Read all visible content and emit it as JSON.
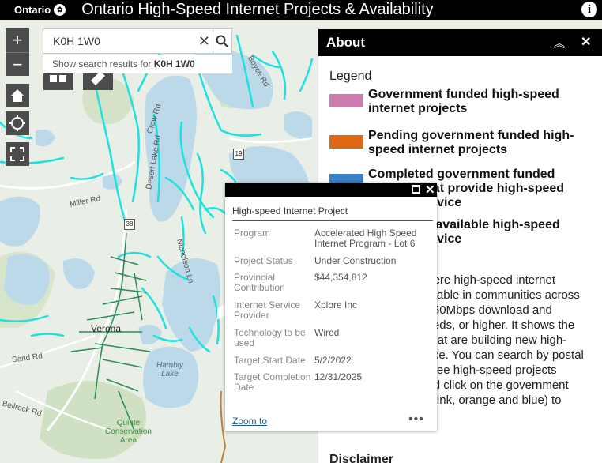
{
  "header": {
    "brand": "Ontario",
    "title": "Ontario High-Speed Internet Projects & Availability",
    "info_icon": "info-icon"
  },
  "map": {
    "labels": {
      "road1": "Miller Rd",
      "road2": "Sand Rd",
      "road3": "Bellrock Rd",
      "road4": "Crow Rd",
      "road5": "Desert Lake Rd",
      "road6": "Nicholson Ln",
      "road7": "Boyce Rd",
      "shield1": "38",
      "shield2": "19",
      "town": "Verona",
      "lake": "Hambly\nLake",
      "park": "Quinte\nConservation\nArea"
    }
  },
  "controls": {
    "zoom_in": "+",
    "zoom_out": "−"
  },
  "search": {
    "value": "K0H 1W0",
    "suggest_prefix": "Show search results for ",
    "suggest_term": "K0H 1W0"
  },
  "about": {
    "title": "About",
    "legend_title": "Legend",
    "legend": [
      {
        "label": "Government funded high-speed internet projects",
        "color": "#d07bb0"
      },
      {
        "label": "Pending government funded high-speed internet projects",
        "color": "#dd6a12"
      },
      {
        "label": "Completed government funded projects that provide high-speed internet service",
        "color": "#3a7fc4"
      },
      {
        "label": "Areas with available high-speed internet service",
        "color": "#4b9a4e"
      }
    ],
    "body": "This map shows where high-speed internet service may be available in communities across Ontario, defined as 50Mbps download and 10Mbps upload speeds, or higher. It shows the provincial projects that are building new high-speed internet service. You can search by postal code or address to see high-speed projects located near you and click on the government funded projects (in pink, orange and blue) to learn more.",
    "disclaimer": "Disclaimer"
  },
  "popup": {
    "title": "High-speed Internet Project",
    "fields": [
      {
        "key": "Program",
        "value": "Accelerated High Speed Internet Program - Lot 6"
      },
      {
        "key": "Project Status",
        "value": "Under Construction"
      },
      {
        "key": "Provincial Contribution",
        "value": "$44,354,812"
      },
      {
        "key": "Internet Service Provider",
        "value": "Xplore Inc"
      },
      {
        "key": "Technology to be used",
        "value": "Wired"
      },
      {
        "key": "Target Start Date",
        "value": "5/2/2022"
      },
      {
        "key": "Target Completion Date",
        "value": "12/31/2025"
      }
    ],
    "zoom_to": "Zoom to",
    "more": "•••"
  },
  "colors": {
    "header_bg": "#000000",
    "internet_lines": "#1ee0e0",
    "project_lines": "#2e8b57",
    "water": "#bcd9ea"
  }
}
